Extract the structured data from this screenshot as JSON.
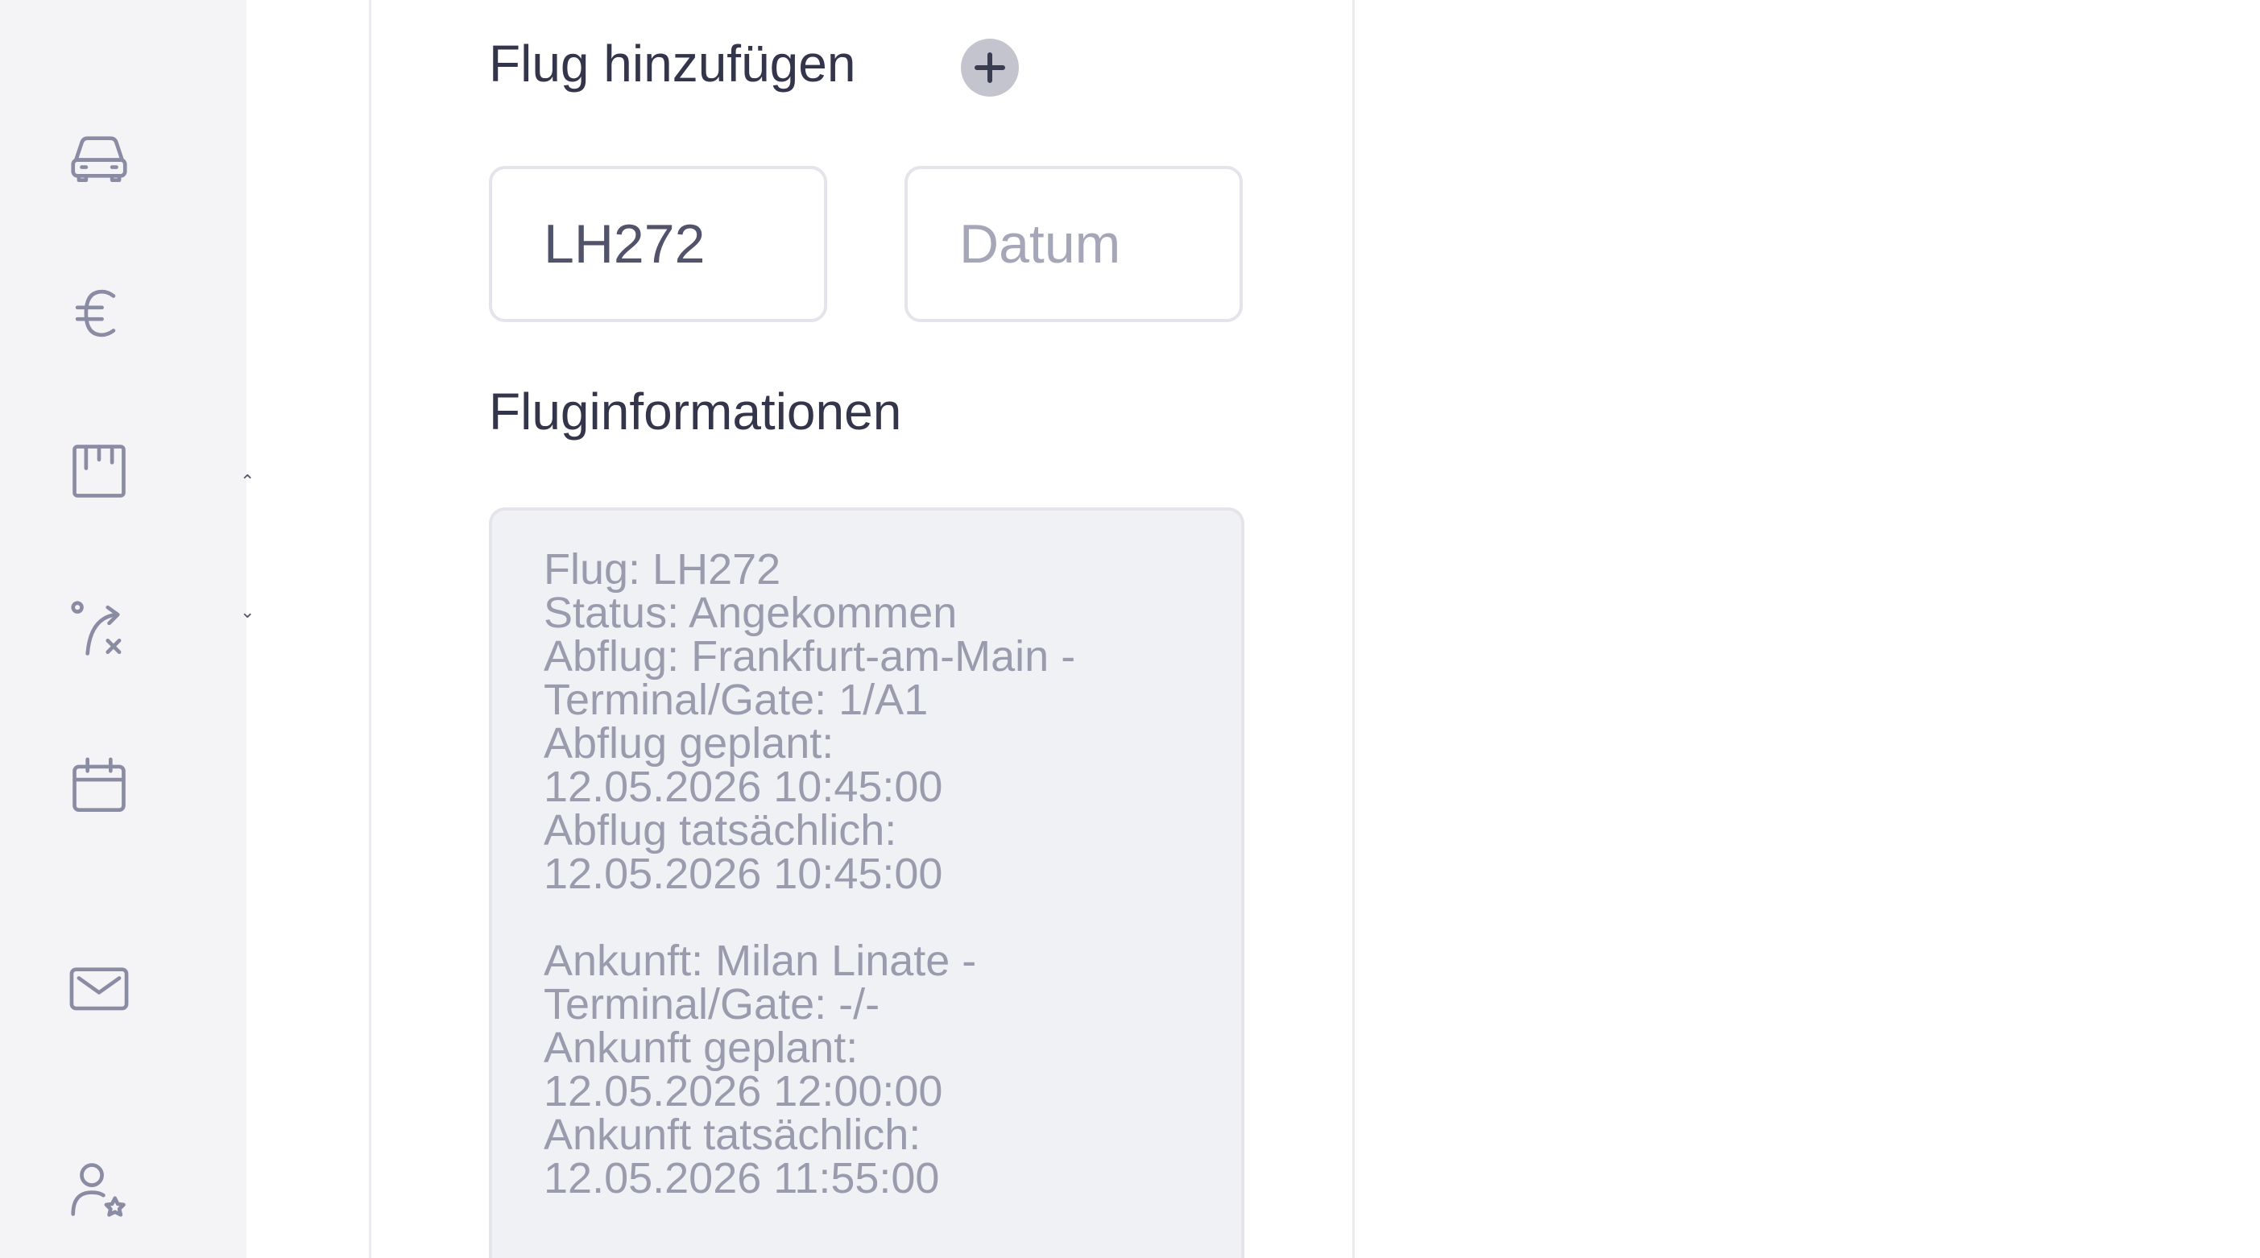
{
  "sidebar": {
    "icons": [
      {
        "name": "car-icon"
      },
      {
        "name": "euro-icon"
      },
      {
        "name": "board-icon"
      },
      {
        "name": "route-cancel-icon"
      },
      {
        "name": "calendar-icon"
      },
      {
        "name": "mail-icon"
      },
      {
        "name": "user-star-icon"
      }
    ]
  },
  "flight": {
    "add_title": "Flug hinzufügen",
    "flight_number_value": "LH272",
    "date_placeholder": "Datum",
    "info_title": "Fluginformationen",
    "info_lines": [
      "Flug: LH272",
      "Status: Angekommen",
      "Abflug: Frankfurt-am-Main -",
      "Terminal/Gate: 1/A1",
      "Abflug geplant:",
      "12.05.2026 10:45:00",
      "Abflug tatsächlich:",
      "12.05.2026 10:45:00",
      "",
      "Ankunft: Milan Linate -",
      "Terminal/Gate: -/-",
      "Ankunft geplant:",
      "12.05.2026 12:00:00",
      "Ankunft tatsächlich:",
      "12.05.2026 11:55:00"
    ]
  },
  "colors": {
    "sidebar_bg": "#f4f4f7",
    "icon_color": "#8a8ca3",
    "text_dark": "#33354a",
    "info_bg": "#f0f1f5"
  }
}
